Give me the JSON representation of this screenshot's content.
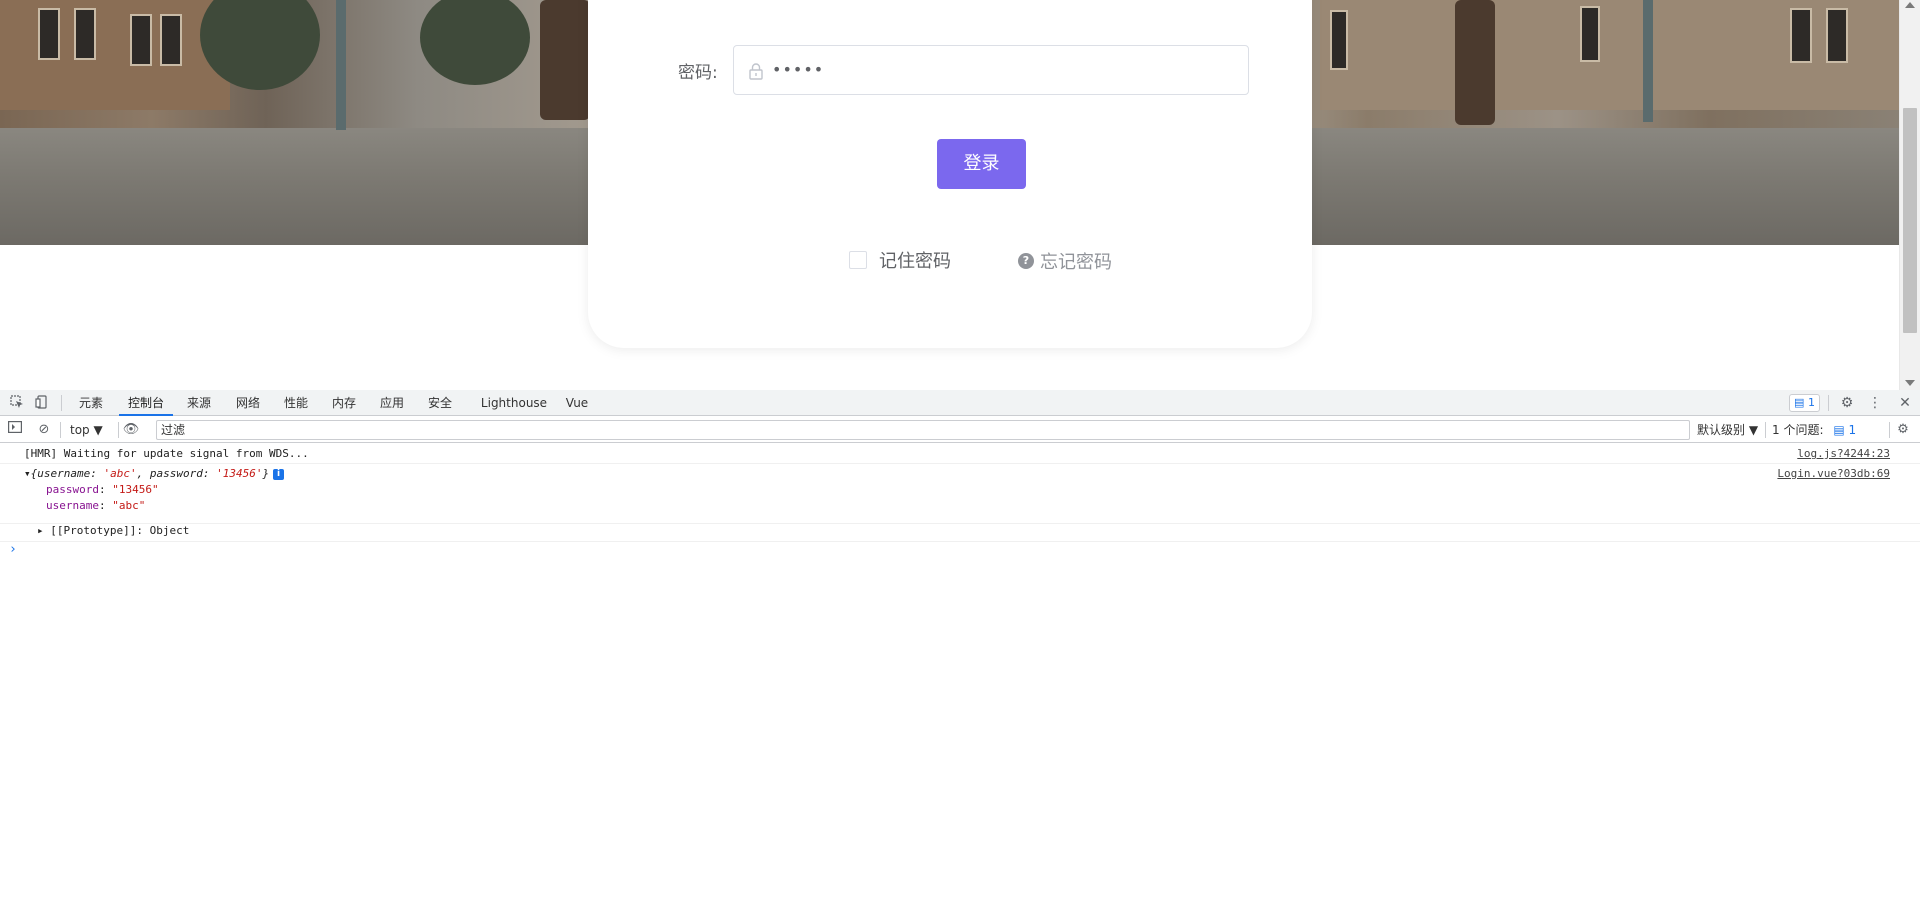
{
  "login": {
    "password_label": "密码:",
    "password_value": "•••••",
    "login_button": "登录",
    "remember_label": "记住密码",
    "forgot_label": "忘记密码",
    "accent_color": "#7b68ee"
  },
  "devtools": {
    "tabs": [
      "元素",
      "控制台",
      "来源",
      "网络",
      "性能",
      "内存",
      "应用",
      "安全",
      "Lighthouse",
      "Vue"
    ],
    "active_tab": "控制台",
    "issues_badge": "1",
    "context": "top",
    "filter_placeholder": "过滤",
    "level": "默认级别",
    "issues_text": "1 个问题:",
    "issues_count": "1"
  },
  "console": {
    "hmr_message": "[HMR] Waiting for update signal from WDS...",
    "hmr_source": "log.js?4244:23",
    "obj_summary_prefix": "{username: ",
    "obj_summary_username": "'abc'",
    "obj_summary_mid": ", password: ",
    "obj_summary_password": "'13456'",
    "obj_summary_suffix": "}",
    "obj_source": "Login.vue?03db:69",
    "password_key": "password",
    "password_value": "\"13456\"",
    "username_key": "username",
    "username_value": "\"abc\"",
    "prototype_text": "[[Prototype]]: Object"
  },
  "icons": {
    "lock": "lock-icon",
    "question": "question-circle-icon",
    "inspect": "inspect-element-icon",
    "device": "device-toolbar-icon",
    "settings": "gear-icon",
    "more": "more-vert-icon",
    "close": "close-icon",
    "sidebar": "sidebar-toggle-icon",
    "clear": "clear-console-icon",
    "eye": "live-expression-icon"
  }
}
